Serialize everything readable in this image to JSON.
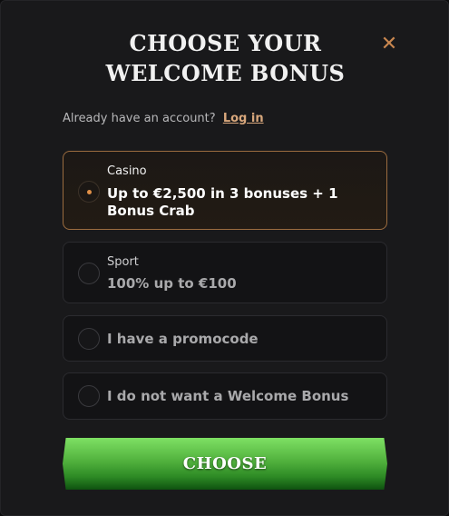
{
  "modal": {
    "title_line1": "CHOOSE YOUR",
    "title_line2": "WELCOME BONUS",
    "close_icon": "close-icon",
    "close_glyph": "✕"
  },
  "account": {
    "prompt": "Already have an account?",
    "login_label": "Log in"
  },
  "options": [
    {
      "category": "Casino",
      "label": "Up to €2,500 in 3 bonuses + 1 Bonus Crab",
      "selected": true
    },
    {
      "category": "Sport",
      "label": "100% up to €100",
      "selected": false
    },
    {
      "category": "",
      "label": "I have a promocode",
      "selected": false
    },
    {
      "category": "",
      "label": "I do not want a Welcome Bonus",
      "selected": false
    }
  ],
  "cta": {
    "label": "CHOOSE"
  },
  "colors": {
    "accent": "#c8864f",
    "cta_green": "#51b13d",
    "selected_border": "#9b6c3f"
  }
}
